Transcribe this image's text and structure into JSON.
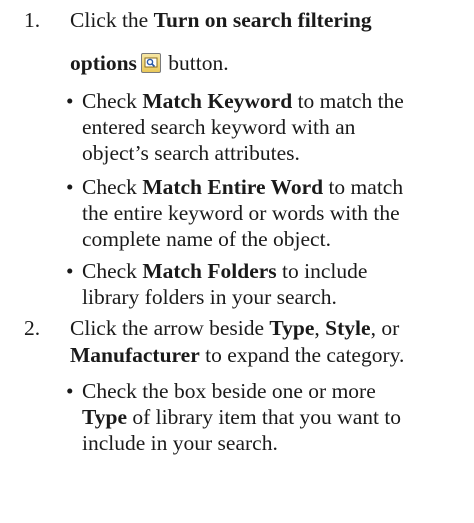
{
  "steps": [
    {
      "number": "1.",
      "line1_bold": "Click the ",
      "line1_b": "Turn on search filtering",
      "line2_b": "options",
      "line2_rest": " button.",
      "icon": "search-filter-icon",
      "bullets": [
        {
          "pre": "Check ",
          "bold": "Match Keyword",
          "post_line1": " to match the",
          "line2": "entered search keyword with an",
          "line3": "object’s search attributes."
        },
        {
          "pre": "Check ",
          "bold": "Match Entire Word",
          "post_line1": " to match",
          "line2": "the entire keyword or words with the",
          "line3": "complete name of the object."
        },
        {
          "pre": "Check ",
          "bold": "Match Folders",
          "post_line1": " to include",
          "line2": "library folders in your search.",
          "line3": ""
        }
      ]
    },
    {
      "number": "2.",
      "line1_pre": "Click the arrow beside ",
      "line1_b1": "Type",
      "line1_sep1": ", ",
      "line1_b2": "Style",
      "line1_sep2": ", or",
      "line2_b": "Manufacturer",
      "line2_rest": " to expand the category.",
      "bullets": [
        {
          "line1": "Check the box beside one or more",
          "line2_b": "Type",
          "line2_rest": " of library item that you want to",
          "line3": "include in your search."
        }
      ]
    }
  ]
}
